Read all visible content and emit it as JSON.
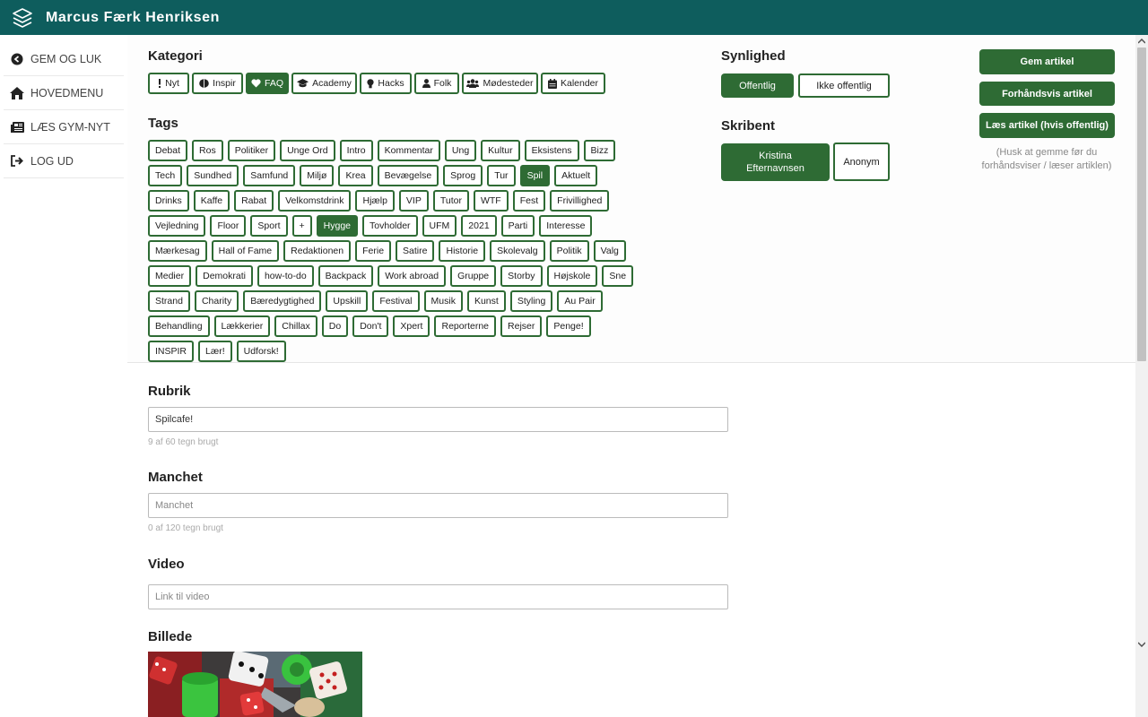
{
  "header": {
    "title": "Marcus Færk Henriksen",
    "logo_icon": "layers-icon",
    "bg_color": "#0e5d5d"
  },
  "sidebar": {
    "items": [
      {
        "label": "GEM OG LUK",
        "icon": "circle-arrow-left-icon"
      },
      {
        "label": "HOVEDMENU",
        "icon": "home-icon"
      },
      {
        "label": "LÆS GYM-NYT",
        "icon": "newspaper-icon"
      },
      {
        "label": "LOG UD",
        "icon": "sign-out-icon"
      }
    ]
  },
  "kategori": {
    "heading": "Kategori",
    "items": [
      {
        "label": "Nyt",
        "icon": "exclamation-icon",
        "selected": false
      },
      {
        "label": "Inspir",
        "icon": "brain-icon",
        "selected": false
      },
      {
        "label": "FAQ",
        "icon": "heart-icon",
        "selected": true
      },
      {
        "label": "Academy",
        "icon": "graduation-cap-icon",
        "selected": false
      },
      {
        "label": "Hacks",
        "icon": "lightbulb-icon",
        "selected": false
      },
      {
        "label": "Folk",
        "icon": "user-icon",
        "selected": false
      },
      {
        "label": "Mødesteder",
        "icon": "users-icon",
        "selected": false
      },
      {
        "label": "Kalender",
        "icon": "calendar-icon",
        "selected": false
      }
    ]
  },
  "tags": {
    "heading": "Tags",
    "items": [
      {
        "label": "Debat",
        "selected": false
      },
      {
        "label": "Ros",
        "selected": false
      },
      {
        "label": "Politiker",
        "selected": false
      },
      {
        "label": "Unge Ord",
        "selected": false
      },
      {
        "label": "Intro",
        "selected": false
      },
      {
        "label": "Kommentar",
        "selected": false
      },
      {
        "label": "Ung",
        "selected": false
      },
      {
        "label": "Kultur",
        "selected": false
      },
      {
        "label": "Eksistens",
        "selected": false
      },
      {
        "label": "Bizz",
        "selected": false
      },
      {
        "label": "Tech",
        "selected": false
      },
      {
        "label": "Sundhed",
        "selected": false
      },
      {
        "label": "Samfund",
        "selected": false
      },
      {
        "label": "Miljø",
        "selected": false
      },
      {
        "label": "Krea",
        "selected": false
      },
      {
        "label": "Bevægelse",
        "selected": false
      },
      {
        "label": "Sprog",
        "selected": false
      },
      {
        "label": "Tur",
        "selected": false
      },
      {
        "label": "Spil",
        "selected": true
      },
      {
        "label": "Aktuelt",
        "selected": false
      },
      {
        "label": "Drinks",
        "selected": false
      },
      {
        "label": "Kaffe",
        "selected": false
      },
      {
        "label": "Rabat",
        "selected": false
      },
      {
        "label": "Velkomstdrink",
        "selected": false
      },
      {
        "label": "Hjælp",
        "selected": false
      },
      {
        "label": "VIP",
        "selected": false
      },
      {
        "label": "Tutor",
        "selected": false
      },
      {
        "label": "WTF",
        "selected": false
      },
      {
        "label": "Fest",
        "selected": false
      },
      {
        "label": "Frivillighed",
        "selected": false
      },
      {
        "label": "Vejledning",
        "selected": false
      },
      {
        "label": "Floor",
        "selected": false
      },
      {
        "label": "Sport",
        "selected": false
      },
      {
        "label": "+",
        "selected": false
      },
      {
        "label": "Hygge",
        "selected": true
      },
      {
        "label": "Tovholder",
        "selected": false
      },
      {
        "label": "UFM",
        "selected": false
      },
      {
        "label": "2021",
        "selected": false
      },
      {
        "label": "Parti",
        "selected": false
      },
      {
        "label": "Interesse",
        "selected": false
      },
      {
        "label": "Mærkesag",
        "selected": false
      },
      {
        "label": "Hall of Fame",
        "selected": false
      },
      {
        "label": "Redaktionen",
        "selected": false
      },
      {
        "label": "Ferie",
        "selected": false
      },
      {
        "label": "Satire",
        "selected": false
      },
      {
        "label": "Historie",
        "selected": false
      },
      {
        "label": "Skolevalg",
        "selected": false
      },
      {
        "label": "Politik",
        "selected": false
      },
      {
        "label": "Valg",
        "selected": false
      },
      {
        "label": "Medier",
        "selected": false
      },
      {
        "label": "Demokrati",
        "selected": false
      },
      {
        "label": "how-to-do",
        "selected": false
      },
      {
        "label": "Backpack",
        "selected": false
      },
      {
        "label": "Work abroad",
        "selected": false
      },
      {
        "label": "Gruppe",
        "selected": false
      },
      {
        "label": "Storby",
        "selected": false
      },
      {
        "label": "Højskole",
        "selected": false
      },
      {
        "label": "Sne",
        "selected": false
      },
      {
        "label": "Strand",
        "selected": false
      },
      {
        "label": "Charity",
        "selected": false
      },
      {
        "label": "Bæredygtighed",
        "selected": false
      },
      {
        "label": "Upskill",
        "selected": false
      },
      {
        "label": "Festival",
        "selected": false
      },
      {
        "label": "Musik",
        "selected": false
      },
      {
        "label": "Kunst",
        "selected": false
      },
      {
        "label": "Styling",
        "selected": false
      },
      {
        "label": "Au Pair",
        "selected": false
      },
      {
        "label": "Behandling",
        "selected": false
      },
      {
        "label": "Lækkerier",
        "selected": false
      },
      {
        "label": "Chillax",
        "selected": false
      },
      {
        "label": "Do",
        "selected": false
      },
      {
        "label": "Don't",
        "selected": false
      },
      {
        "label": "Xpert",
        "selected": false
      },
      {
        "label": "Reporterne",
        "selected": false
      },
      {
        "label": "Rejser",
        "selected": false
      },
      {
        "label": "Penge!",
        "selected": false
      },
      {
        "label": "INSPIR",
        "selected": false
      },
      {
        "label": "Lær!",
        "selected": false
      },
      {
        "label": "Udforsk!",
        "selected": false
      }
    ]
  },
  "synlighed": {
    "heading": "Synlighed",
    "options": [
      {
        "label": "Offentlig",
        "selected": true
      },
      {
        "label": "Ikke offentlig",
        "selected": false
      }
    ]
  },
  "skribent": {
    "heading": "Skribent",
    "options": [
      {
        "label": "Kristina Efternavnsen",
        "selected": true
      },
      {
        "label": "Anonym",
        "selected": false
      }
    ]
  },
  "actions": {
    "save": "Gem artikel",
    "preview": "Forhåndsvis artikel",
    "read": "Læs artikel (hvis offentlig)",
    "hint": "(Husk at gemme før du forhåndsviser / læser artiklen)"
  },
  "form": {
    "rubrik": {
      "heading": "Rubrik",
      "value": "Spilcafe!",
      "counter": "9 af 60 tegn brugt"
    },
    "manchet": {
      "heading": "Manchet",
      "value": "",
      "placeholder": "Manchet",
      "counter": "0 af 120 tegn brugt"
    },
    "video": {
      "heading": "Video",
      "value": "",
      "placeholder": "Link til video"
    },
    "billede": {
      "heading": "Billede"
    }
  },
  "colors": {
    "accent": "#2e6b34",
    "header": "#0e5d5d"
  }
}
